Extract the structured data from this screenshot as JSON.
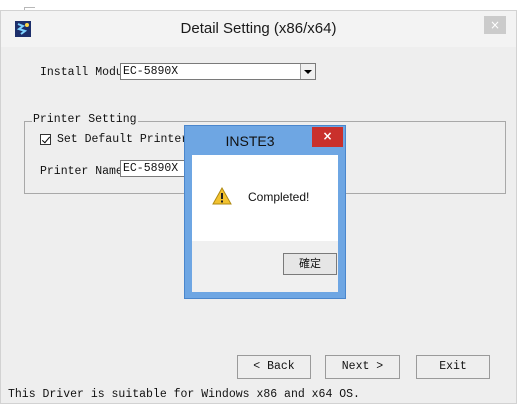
{
  "window": {
    "title": "Detail Setting (x86/x64)",
    "close_glyph": "×",
    "icon": "app-icon"
  },
  "install": {
    "label": "Install Module",
    "selected_value": "EC-5890X"
  },
  "printer_setting": {
    "group_label": "Printer Setting",
    "set_default_label": "Set Default Printer",
    "set_default_checked": true,
    "printer_name_label": "Printer Name",
    "printer_name_value": "EC-5890X"
  },
  "buttons": {
    "back": "< Back",
    "next": "Next >",
    "exit": "Exit"
  },
  "footer": "This Driver is suitable for Windows x86 and x64 OS.",
  "dialog": {
    "title": "INSTE3",
    "close_glyph": "×",
    "message": "Completed!",
    "ok_label": "確定",
    "icon": "warning-icon"
  },
  "colors": {
    "dialog_frame": "#6ea6e3",
    "dialog_close": "#c9302c",
    "window_bg": "#eeeeee"
  }
}
